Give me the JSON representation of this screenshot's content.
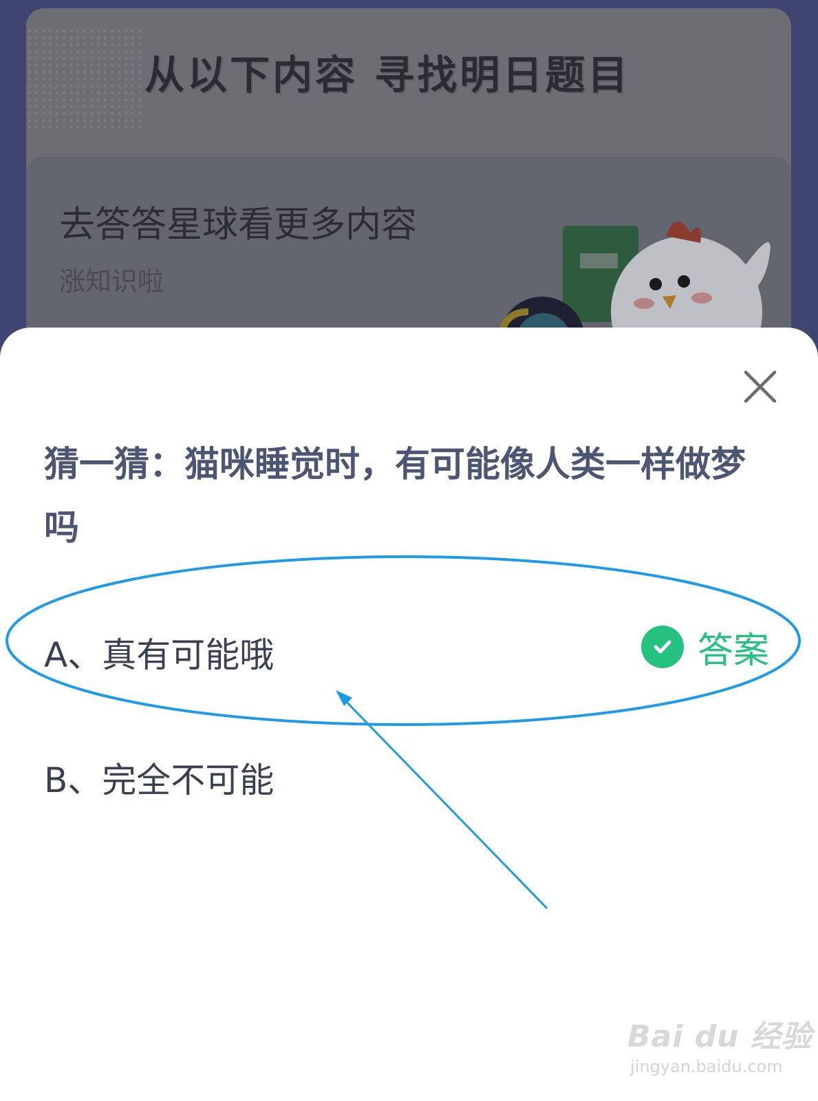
{
  "background": {
    "banner_heading": "从以下内容 寻找明日题目",
    "card_title": "去答答星球看更多内容",
    "card_subtitle": "涨知识啦"
  },
  "quiz": {
    "question": "猜一猜：猫咪睡觉时，有可能像人类一样做梦吗",
    "options": [
      {
        "label": "A、真有可能哦",
        "is_answer": true
      },
      {
        "label": "B、完全不可能",
        "is_answer": false
      }
    ],
    "answer_label": "答案"
  },
  "icons": {
    "close": "close-icon",
    "check": "check-circle-icon",
    "mascot": "chicken-mascot"
  },
  "colors": {
    "answer_green": "#24c27e",
    "highlight_blue": "#1e9be6",
    "question_text": "#4c5673"
  },
  "watermark": {
    "brand": "Bai du 经验",
    "url": "jingyan.baidu.com"
  }
}
